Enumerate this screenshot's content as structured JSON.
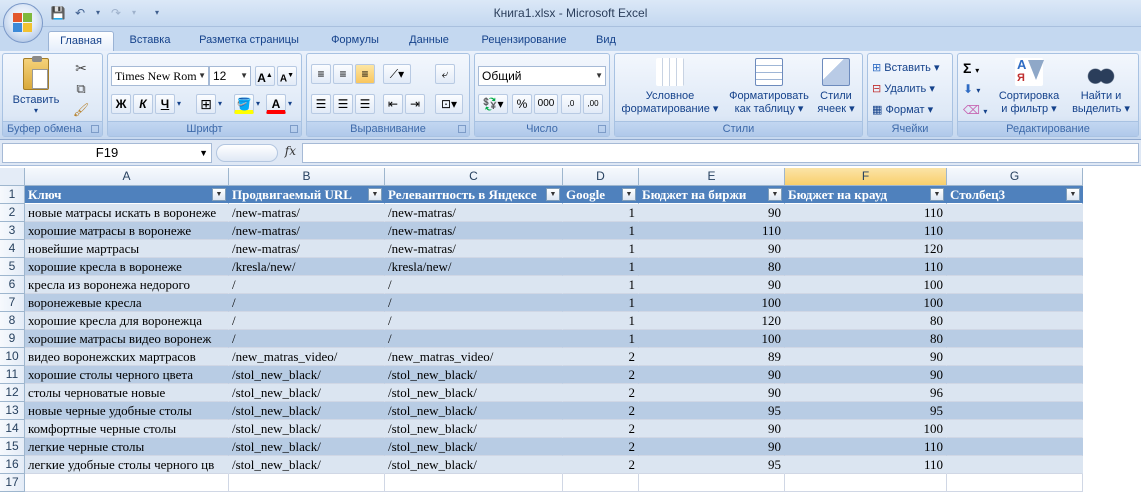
{
  "window": {
    "title": "Книга1.xlsx - Microsoft Excel"
  },
  "tabs": [
    {
      "label": "Главная",
      "active": true
    },
    {
      "label": "Вставка"
    },
    {
      "label": "Разметка страницы"
    },
    {
      "label": "Формулы"
    },
    {
      "label": "Данные"
    },
    {
      "label": "Рецензирование"
    },
    {
      "label": "Вид"
    }
  ],
  "ribbon": {
    "clipboard": {
      "label": "Буфер обмена",
      "paste": "Вставить"
    },
    "font": {
      "label": "Шрифт",
      "font_name": "Times New Rom",
      "font_size": "12",
      "bold": "Ж",
      "italic": "К",
      "underline": "Ч"
    },
    "alignment": {
      "label": "Выравнивание"
    },
    "number": {
      "label": "Число",
      "format": "Общий",
      "percent": "%",
      "thousands": "000"
    },
    "styles": {
      "label": "Стили",
      "conditional": [
        "Условное",
        "форматирование ▾"
      ],
      "as_table": [
        "Форматировать",
        "как таблицу ▾"
      ],
      "cell_styles": [
        "Стили",
        "ячеек ▾"
      ]
    },
    "cells": {
      "label": "Ячейки",
      "insert": "Вставить ▾",
      "delete": "Удалить ▾",
      "format": "Формат ▾"
    },
    "editing": {
      "label": "Редактирование",
      "sort": [
        "Сортировка",
        "и фильтр ▾"
      ],
      "find": [
        "Найти и",
        "выделить ▾"
      ]
    }
  },
  "formula_bar": {
    "name_box": "F19",
    "fx": "fx",
    "value": ""
  },
  "colors": {
    "header": "#4f81bd",
    "band1": "#b8cce4",
    "band2": "#dbe5f1"
  },
  "sheet": {
    "columns": [
      "A",
      "B",
      "C",
      "D",
      "E",
      "F",
      "G"
    ],
    "selected_column": "F",
    "row_numbers": [
      "1",
      "2",
      "3",
      "4",
      "5",
      "6",
      "7",
      "8",
      "9",
      "10",
      "11",
      "12",
      "13",
      "14",
      "15",
      "16",
      "17"
    ],
    "table_headers": [
      "Ключ",
      "Продвигаемый URL",
      "Релевантность в Яндексе",
      "Google",
      "Бюджет на биржи",
      "Бюджет на крауд",
      "Столбец3"
    ],
    "rows": [
      [
        "новые матрасы искать в воронеже",
        "/new-matras/",
        "/new-matras/",
        "1",
        "90",
        "110",
        ""
      ],
      [
        "хорошие матрасы в воронеже",
        "/new-matras/",
        "/new-matras/",
        "1",
        "110",
        "110",
        ""
      ],
      [
        "новейшие мартрасы",
        "/new-matras/",
        "/new-matras/",
        "1",
        "90",
        "120",
        ""
      ],
      [
        "хорошие кресла в воронеже",
        "/kresla/new/",
        "/kresla/new/",
        "1",
        "80",
        "110",
        ""
      ],
      [
        "кресла из воронежа недорого",
        "/",
        "/",
        "1",
        "90",
        "100",
        ""
      ],
      [
        "воронежевые кресла",
        "/",
        "/",
        "1",
        "100",
        "100",
        ""
      ],
      [
        "хорошие кресла для воронежца",
        "/",
        "/",
        "1",
        "120",
        "80",
        ""
      ],
      [
        "хорошие матрасы видео воронеж",
        "/",
        "/",
        "1",
        "100",
        "80",
        ""
      ],
      [
        "видео воронежских мартрасов",
        "/new_matras_video/",
        "/new_matras_video/",
        "2",
        "89",
        "90",
        ""
      ],
      [
        "хорошие столы черного цвета",
        "/stol_new_black/",
        "/stol_new_black/",
        "2",
        "90",
        "90",
        ""
      ],
      [
        "столы черноватые новые",
        "/stol_new_black/",
        "/stol_new_black/",
        "2",
        "90",
        "96",
        ""
      ],
      [
        "новые черные удобные столы",
        "/stol_new_black/",
        "/stol_new_black/",
        "2",
        "95",
        "95",
        ""
      ],
      [
        "комфортные черные столы",
        "/stol_new_black/",
        "/stol_new_black/",
        "2",
        "90",
        "100",
        ""
      ],
      [
        "легкие черные столы",
        "/stol_new_black/",
        "/stol_new_black/",
        "2",
        "90",
        "110",
        ""
      ],
      [
        "легкие удобные столы черного цв",
        "/stol_new_black/",
        "/stol_new_black/",
        "2",
        "95",
        "110",
        ""
      ]
    ]
  }
}
